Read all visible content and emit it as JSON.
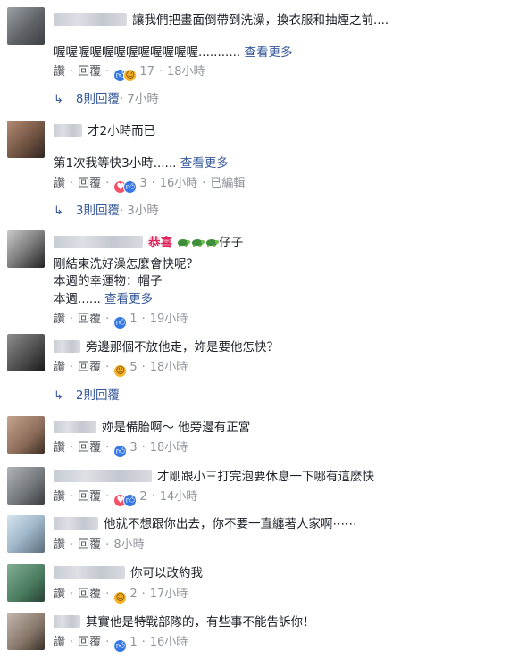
{
  "labels": {
    "like": "讚",
    "reply": "回覆",
    "dot": "·"
  },
  "comments": [
    {
      "text": "讓我們把畫面倒帶到洗澡，換衣服和抽煙之前....",
      "line2": "喔喔喔喔喔喔喔喔喔喔喔喔",
      "ellipsis": "...........",
      "see_more": "查看更多",
      "reactions": [
        "like",
        "haha"
      ],
      "count": "17",
      "time": "18小時",
      "replies": {
        "label": "8則回覆",
        "time": "7小時"
      }
    },
    {
      "text": "才2小時而已",
      "line2": "第1次我等快3小時",
      "ellipsis": "......",
      "see_more": "查看更多",
      "reactions": [
        "love",
        "like"
      ],
      "count": "3",
      "time": "16小時",
      "edited": "已編輯",
      "replies": {
        "label": "3則回覆",
        "time": "3小時"
      }
    },
    {
      "name_badge": "恭喜",
      "text": "仔子",
      "line2": "剛結束洗好澡怎麼會快呢？",
      "line3": "本週的幸運物：帽子",
      "line4": "本週",
      "ellipsis": "......",
      "see_more": "查看更多",
      "reactions": [
        "like"
      ],
      "count": "1",
      "time": "19小時"
    },
    {
      "text": "旁邊那個不放他走，妳是要他怎快？",
      "reactions": [
        "haha"
      ],
      "count": "5",
      "time": "18小時",
      "replies": {
        "label": "2則回覆"
      }
    },
    {
      "text": "妳是備胎啊～ 他旁邊有正宮",
      "reactions": [
        "like"
      ],
      "count": "3",
      "time": "18小時"
    },
    {
      "text": "才剛跟小三打完泡要休息一下哪有這麼快",
      "reactions": [
        "love",
        "like"
      ],
      "count": "2",
      "time": "14小時"
    },
    {
      "text": "他就不想跟你出去，你不要一直纏著人家啊⋯⋯",
      "time": "8小時"
    },
    {
      "text": "你可以改約我",
      "reactions": [
        "haha"
      ],
      "count": "2",
      "time": "17小時"
    },
    {
      "text": "其實他是特戰部隊的，有些事不能告訴你！",
      "reactions": [
        "like"
      ],
      "count": "1",
      "time": "16小時"
    }
  ],
  "icons": {
    "like": "thumbs-up-icon",
    "haha": "laughing-face-icon",
    "love": "heart-icon",
    "reply_arrow": "reply-arrow-icon",
    "turtle": "turtle-emoji-icon"
  },
  "colors": {
    "link": "#365899",
    "meta": "#90949c",
    "like": "#3578e5",
    "haha": "#f7b125",
    "love": "#f25268",
    "badge": "#e0245e"
  }
}
